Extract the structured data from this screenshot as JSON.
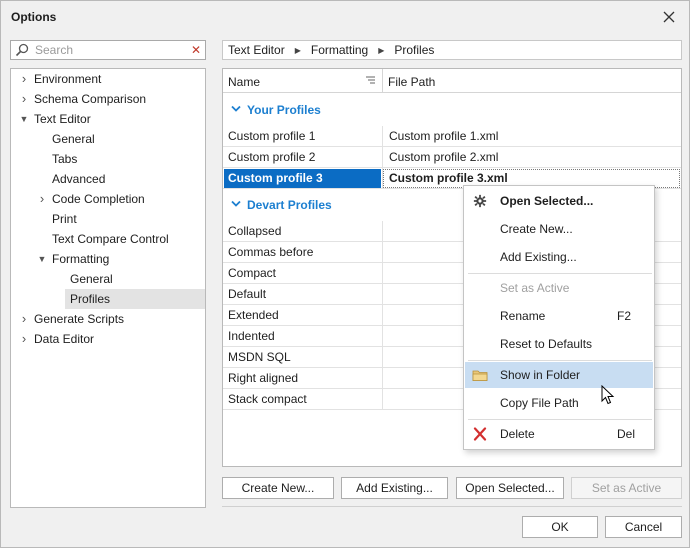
{
  "window": {
    "title": "Options"
  },
  "search": {
    "placeholder": "Search"
  },
  "tree": [
    {
      "label": "Environment",
      "level": 0,
      "expander": "collapsed"
    },
    {
      "label": "Schema Comparison",
      "level": 0,
      "expander": "collapsed"
    },
    {
      "label": "Text Editor",
      "level": 0,
      "expander": "expanded"
    },
    {
      "label": "General",
      "level": 1,
      "expander": "none"
    },
    {
      "label": "Tabs",
      "level": 1,
      "expander": "none"
    },
    {
      "label": "Advanced",
      "level": 1,
      "expander": "none"
    },
    {
      "label": "Code Completion",
      "level": 1,
      "expander": "collapsed"
    },
    {
      "label": "Print",
      "level": 1,
      "expander": "none"
    },
    {
      "label": "Text Compare Control",
      "level": 1,
      "expander": "none"
    },
    {
      "label": "Formatting",
      "level": 1,
      "expander": "expanded"
    },
    {
      "label": "General",
      "level": 2,
      "expander": "none"
    },
    {
      "label": "Profiles",
      "level": 2,
      "expander": "none",
      "selected": true
    },
    {
      "label": "Generate Scripts",
      "level": 0,
      "expander": "collapsed"
    },
    {
      "label": "Data Editor",
      "level": 0,
      "expander": "collapsed"
    }
  ],
  "breadcrumb": [
    "Text Editor",
    "Formatting",
    "Profiles"
  ],
  "grid": {
    "columns": {
      "name": "Name",
      "path": "File Path"
    },
    "groups": [
      {
        "label": "Your Profiles",
        "rows": [
          {
            "name": "Custom profile 1",
            "path": "Custom profile 1.xml"
          },
          {
            "name": "Custom profile 2",
            "path": "Custom profile 2.xml"
          },
          {
            "name": "Custom profile 3",
            "path": "Custom profile 3.xml",
            "active": true
          }
        ]
      },
      {
        "label": "Devart Profiles",
        "rows": [
          {
            "name": "Collapsed",
            "path": ""
          },
          {
            "name": "Commas before",
            "path": ""
          },
          {
            "name": "Compact",
            "path": ""
          },
          {
            "name": "Default",
            "path": ""
          },
          {
            "name": "Extended",
            "path": ""
          },
          {
            "name": "Indented",
            "path": ""
          },
          {
            "name": "MSDN SQL",
            "path": ""
          },
          {
            "name": "Right aligned",
            "path": ""
          },
          {
            "name": "Stack compact",
            "path": ""
          }
        ]
      }
    ]
  },
  "buttons": {
    "create_new": "Create New...",
    "add_existing": "Add Existing...",
    "open_selected": "Open Selected...",
    "set_as_active": "Set as Active",
    "ok": "OK",
    "cancel": "Cancel"
  },
  "context_menu": {
    "open_selected": "Open Selected...",
    "create_new": "Create New...",
    "add_existing": "Add Existing...",
    "set_as_active": "Set as Active",
    "rename": "Rename",
    "rename_key": "F2",
    "reset_defaults": "Reset to Defaults",
    "show_in_folder": "Show in Folder",
    "copy_file_path": "Copy File Path",
    "delete": "Delete",
    "delete_key": "Del"
  },
  "colors": {
    "accent_blue": "#0b6cc4",
    "group_label": "#1c7fd0",
    "menu_hover": "#c8ddf2",
    "delete_icon": "#d32f2f"
  }
}
